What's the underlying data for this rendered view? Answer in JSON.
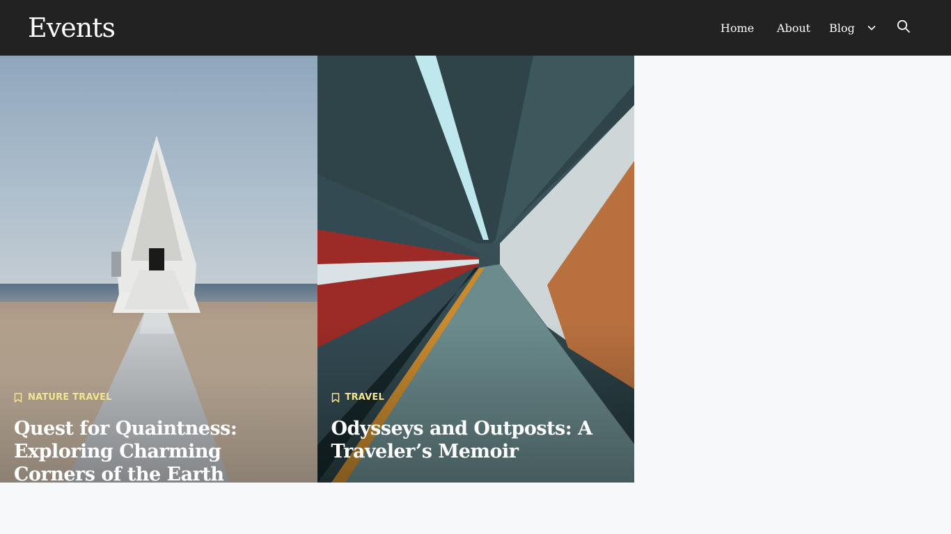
{
  "site": {
    "title": "Events"
  },
  "nav": {
    "items": [
      {
        "label": "Home"
      },
      {
        "label": "About"
      },
      {
        "label": "Blog"
      }
    ],
    "search_icon": "search-icon",
    "blog_icon": "chevron-down-icon"
  },
  "colors": {
    "header_bg": "#222222",
    "page_bg": "#f7f8fa",
    "category_text": "#f3e58f",
    "title_text": "#ffffff"
  },
  "cards": [
    {
      "category": "NATURE TRAVEL",
      "title": "Quest for Quaintness: Exploring Charming Corners of the Earth",
      "category_icon": "bookmark-icon",
      "image": "beach-chapel-photo"
    },
    {
      "category": "TRAVEL",
      "title": "Odysseys and Outposts: A Traveler’s Memoir",
      "category_icon": "bookmark-icon",
      "image": "subway-platform-photo"
    }
  ]
}
